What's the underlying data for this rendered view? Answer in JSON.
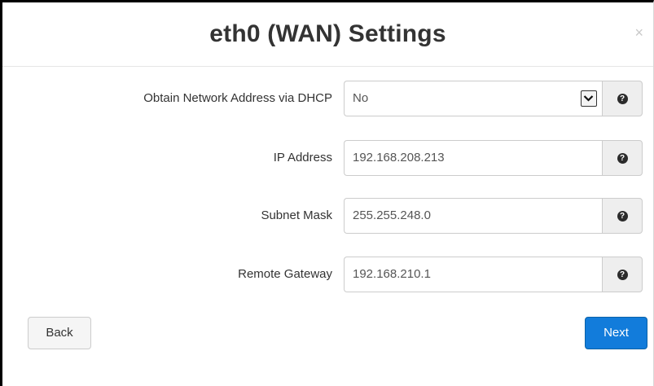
{
  "modal": {
    "title": "eth0 (WAN) Settings",
    "close_symbol": "×"
  },
  "form": {
    "dhcp": {
      "label": "Obtain Network Address via DHCP",
      "value": "No",
      "icon": "chevron-down-icon"
    },
    "ip_address": {
      "label": "IP Address",
      "value": "192.168.208.213"
    },
    "subnet_mask": {
      "label": "Subnet Mask",
      "value": "255.255.248.0"
    },
    "remote_gateway": {
      "label": "Remote Gateway",
      "value": "192.168.210.1"
    },
    "help_symbol": "?",
    "help_icon": "question-circle-icon"
  },
  "buttons": {
    "back": "Back",
    "next": "Next"
  },
  "colors": {
    "primary": "#127cdb",
    "title": "#333333",
    "frame": "#000000"
  }
}
